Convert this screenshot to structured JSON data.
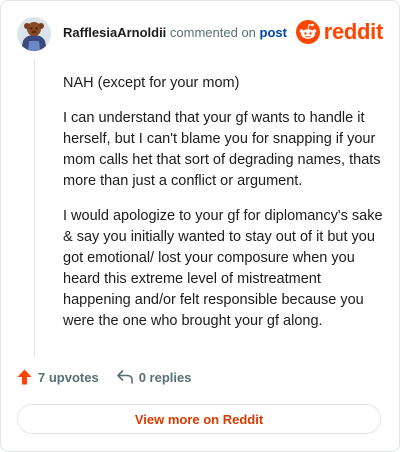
{
  "header": {
    "username": "RafflesiaArnoldii",
    "action_text": "commented on",
    "post_link": "post"
  },
  "logo": {
    "wordmark": "reddit",
    "icon": "reddit-snoo-icon",
    "color": "#ff4500"
  },
  "comment": {
    "paragraphs": [
      "NAH (except for your mom)",
      "I can understand that your gf wants to handle it herself, but I can't blame you for snapping if your mom calls het that sort of degrading names, thats more than just a conflict or argument.",
      "I would apologize to your gf for diplomancy's sake & say you initially wanted to stay out of it but you got emotional/ lost your composure when you heard this extreme level of mistreatment happening and/or felt responsible because you were the one who brought your gf along."
    ]
  },
  "actions": {
    "upvotes_label": "7 upvotes",
    "upvote_icon": "upvote-arrow-icon",
    "replies_label": "0 replies",
    "reply_icon": "reply-arrow-icon"
  },
  "footer": {
    "view_more_label": "View more on Reddit"
  },
  "colors": {
    "accent": "#ff4500",
    "link": "#0045ac",
    "button_text": "#d93a00"
  }
}
